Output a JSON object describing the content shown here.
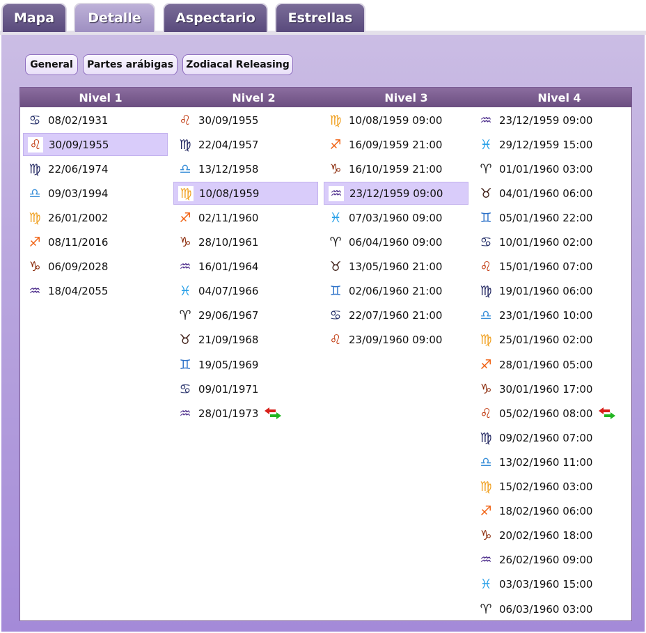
{
  "tabs": [
    {
      "label": "Mapa",
      "active": false
    },
    {
      "label": "Detalle",
      "active": true
    },
    {
      "label": "Aspectario",
      "active": false
    },
    {
      "label": "Estrellas",
      "active": false
    }
  ],
  "subtabs": [
    "General",
    "Partes arábigas",
    "Zodiacal Releasing"
  ],
  "sign_colors": {
    "cancer": "#26306a",
    "leo": "#c13a10",
    "virgo": "#232862",
    "libra": "#3a8fd8",
    "scorpio": "#f0a020",
    "sagittarius": "#f06010",
    "capricorn": "#8b2a0a",
    "aquarius": "#4a2a8a",
    "pisces": "#28a0e8",
    "aries": "#202020",
    "taurus": "#402018",
    "gemini": "#2a70c8"
  },
  "sign_glyphs": {
    "cancer": "♋︎",
    "leo": "♌︎",
    "virgo": "♍︎",
    "libra": "♎︎",
    "scorpio": "♍︎",
    "sagittarius": "♐︎",
    "capricorn": "♑︎",
    "aquarius": "♒︎",
    "pisces": "♓︎",
    "aries": "♈︎",
    "taurus": "♉︎",
    "gemini": "♊︎"
  },
  "columns": [
    {
      "header": "Nivel 1",
      "rows": [
        {
          "sign": "cancer",
          "date": "08/02/1931"
        },
        {
          "sign": "leo",
          "date": "30/09/1955",
          "selected": true
        },
        {
          "sign": "virgo",
          "date": "22/06/1974"
        },
        {
          "sign": "libra",
          "date": "09/03/1994"
        },
        {
          "sign": "scorpio",
          "date": "26/01/2002"
        },
        {
          "sign": "sagittarius",
          "date": "08/11/2016"
        },
        {
          "sign": "capricorn",
          "date": "06/09/2028"
        },
        {
          "sign": "aquarius",
          "date": "18/04/2055"
        }
      ]
    },
    {
      "header": "Nivel 2",
      "rows": [
        {
          "sign": "leo",
          "date": "30/09/1955"
        },
        {
          "sign": "virgo",
          "date": "22/04/1957"
        },
        {
          "sign": "libra",
          "date": "13/12/1958"
        },
        {
          "sign": "scorpio",
          "date": "10/08/1959",
          "selected": true
        },
        {
          "sign": "sagittarius",
          "date": "02/11/1960"
        },
        {
          "sign": "capricorn",
          "date": "28/10/1961"
        },
        {
          "sign": "aquarius",
          "date": "16/01/1964"
        },
        {
          "sign": "pisces",
          "date": "04/07/1966"
        },
        {
          "sign": "aries",
          "date": "29/06/1967"
        },
        {
          "sign": "taurus",
          "date": "21/09/1968"
        },
        {
          "sign": "gemini",
          "date": "19/05/1969"
        },
        {
          "sign": "cancer",
          "date": "09/01/1971"
        },
        {
          "sign": "aquarius",
          "date": "28/01/1973",
          "swap": true
        }
      ]
    },
    {
      "header": "Nivel 3",
      "rows": [
        {
          "sign": "scorpio",
          "date": "10/08/1959 09:00"
        },
        {
          "sign": "sagittarius",
          "date": "16/09/1959 21:00"
        },
        {
          "sign": "capricorn",
          "date": "16/10/1959 21:00"
        },
        {
          "sign": "aquarius",
          "date": "23/12/1959 09:00",
          "selected": true
        },
        {
          "sign": "pisces",
          "date": "07/03/1960 09:00"
        },
        {
          "sign": "aries",
          "date": "06/04/1960 09:00"
        },
        {
          "sign": "taurus",
          "date": "13/05/1960 21:00"
        },
        {
          "sign": "gemini",
          "date": "02/06/1960 21:00"
        },
        {
          "sign": "cancer",
          "date": "22/07/1960 21:00"
        },
        {
          "sign": "leo",
          "date": "23/09/1960 09:00"
        }
      ]
    },
    {
      "header": "Nivel 4",
      "rows": [
        {
          "sign": "aquarius",
          "date": "23/12/1959 09:00"
        },
        {
          "sign": "pisces",
          "date": "29/12/1959 15:00"
        },
        {
          "sign": "aries",
          "date": "01/01/1960 03:00"
        },
        {
          "sign": "taurus",
          "date": "04/01/1960 06:00"
        },
        {
          "sign": "gemini",
          "date": "05/01/1960 22:00"
        },
        {
          "sign": "cancer",
          "date": "10/01/1960 02:00"
        },
        {
          "sign": "leo",
          "date": "15/01/1960 07:00"
        },
        {
          "sign": "virgo",
          "date": "19/01/1960 06:00"
        },
        {
          "sign": "libra",
          "date": "23/01/1960 10:00"
        },
        {
          "sign": "scorpio",
          "date": "25/01/1960 02:00"
        },
        {
          "sign": "sagittarius",
          "date": "28/01/1960 05:00"
        },
        {
          "sign": "capricorn",
          "date": "30/01/1960 17:00"
        },
        {
          "sign": "leo",
          "date": "05/02/1960 08:00",
          "swap": true
        },
        {
          "sign": "virgo",
          "date": "09/02/1960 07:00"
        },
        {
          "sign": "libra",
          "date": "13/02/1960 11:00"
        },
        {
          "sign": "scorpio",
          "date": "15/02/1960 03:00"
        },
        {
          "sign": "sagittarius",
          "date": "18/02/1960 06:00"
        },
        {
          "sign": "capricorn",
          "date": "20/02/1960 18:00"
        },
        {
          "sign": "aquarius",
          "date": "26/02/1960 09:00"
        },
        {
          "sign": "pisces",
          "date": "03/03/1960 15:00"
        },
        {
          "sign": "aries",
          "date": "06/03/1960 03:00"
        }
      ]
    }
  ]
}
